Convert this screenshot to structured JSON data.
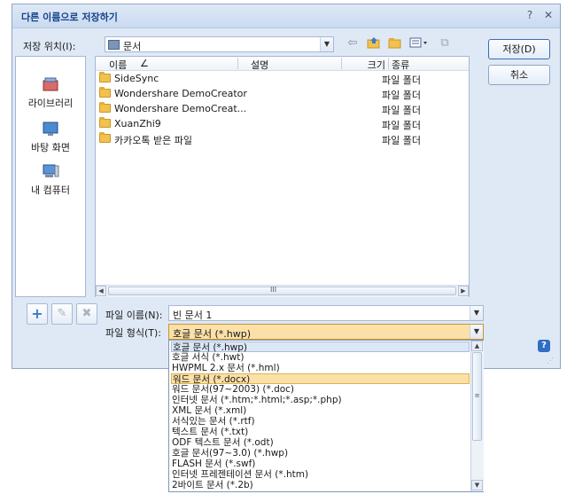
{
  "dialog": {
    "title": "다른 이름으로 저장하기",
    "help_glyph": "?",
    "close_glyph": "✕"
  },
  "location": {
    "label": "저장 위치(I):",
    "value": "문서"
  },
  "places": [
    {
      "label": "라이브러리",
      "icon": "library-icon"
    },
    {
      "label": "바탕 화면",
      "icon": "desktop-icon"
    },
    {
      "label": "내 컴퓨터",
      "icon": "computer-icon"
    }
  ],
  "columns": {
    "name": "이름",
    "sort_glyph": "∠",
    "desc": "설명",
    "size": "크기",
    "type": "종류"
  },
  "files": [
    {
      "name": "SideSync",
      "type": "파일 폴더"
    },
    {
      "name": "Wondershare DemoCreator",
      "type": "파일 폴더"
    },
    {
      "name": "Wondershare DemoCreat...",
      "type": "파일 폴더"
    },
    {
      "name": "XuanZhi9",
      "type": "파일 폴더"
    },
    {
      "name": "카카오톡 받은 파일",
      "type": "파일 폴더"
    }
  ],
  "scroll_mid_glyph": "III",
  "filename": {
    "label": "파일 이름(N):",
    "value": "빈 문서 1"
  },
  "filetype": {
    "label": "파일 형식(T):",
    "value": "호글 문서 (*.hwp)"
  },
  "buttons": {
    "save": "저장(D)",
    "cancel": "취소",
    "help": "?"
  },
  "options": [
    "호글 문서 (*.hwp)",
    "호글 서식 (*.hwt)",
    "HWPML 2.x 문서 (*.hml)",
    "워드 문서 (*.docx)",
    "워드 문서(97~2003) (*.doc)",
    "인터넷 문서 (*.htm;*.html;*.asp;*.php)",
    "XML 문서 (*.xml)",
    "서식있는 문서 (*.rtf)",
    "텍스트 문서 (*.txt)",
    "ODF 텍스트 문서 (*.odt)",
    "호글 문서(97~3.0) (*.hwp)",
    "FLASH 문서 (*.swf)",
    "인터넷 프레젠테이션 문서 (*.htm)",
    "2바이트 문서 (*.2b)"
  ],
  "colors": {
    "title": "#15428b",
    "selection": "#fbe0a8",
    "folder": "#f2c14e"
  }
}
